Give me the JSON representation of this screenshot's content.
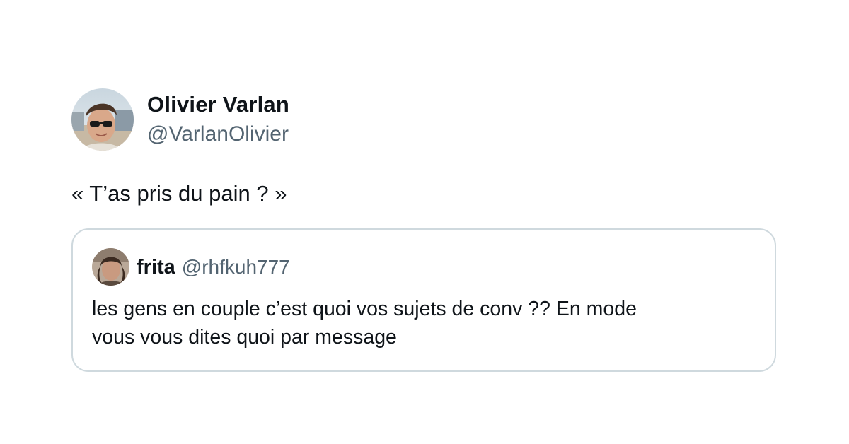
{
  "tweet": {
    "author": {
      "display_name": "Olivier Varlan",
      "handle": "@VarlanOlivier",
      "avatar_icon": "profile-photo-avatar"
    },
    "text": "« T’as pris du pain ? »",
    "quoted_tweet": {
      "author": {
        "display_name": "frita",
        "handle": "@rhfkuh777",
        "avatar_icon": "profile-photo-avatar"
      },
      "text_lines": [
        "les gens en couple c’est quoi vos sujets de conv ?? En mode",
        "vous vous dites quoi par message"
      ]
    }
  },
  "colors": {
    "primary_text": "#0f1419",
    "secondary_text": "#536471",
    "border": "#cfd9de",
    "background": "#ffffff"
  }
}
